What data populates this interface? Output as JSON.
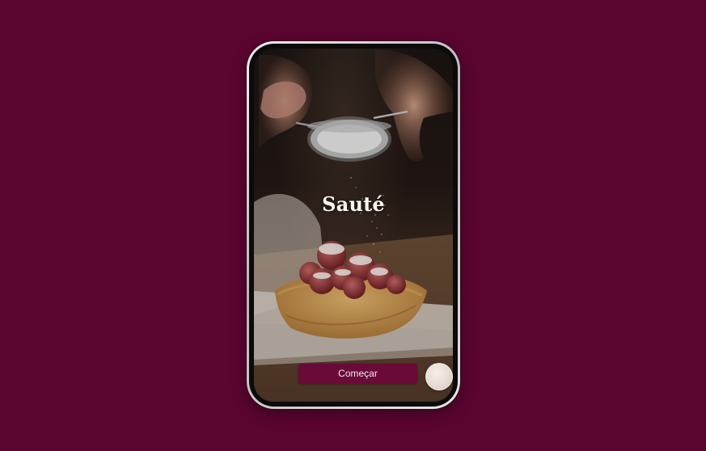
{
  "app": {
    "brand_name": "Sauté"
  },
  "actions": {
    "start_label": "Começar"
  },
  "icons": {
    "floating_control": "circle-button-icon"
  },
  "colors": {
    "background": "#5a0530",
    "button_background": "#6a0a38",
    "button_text": "#f4e9ee",
    "title_text": "#fbf6f2"
  }
}
